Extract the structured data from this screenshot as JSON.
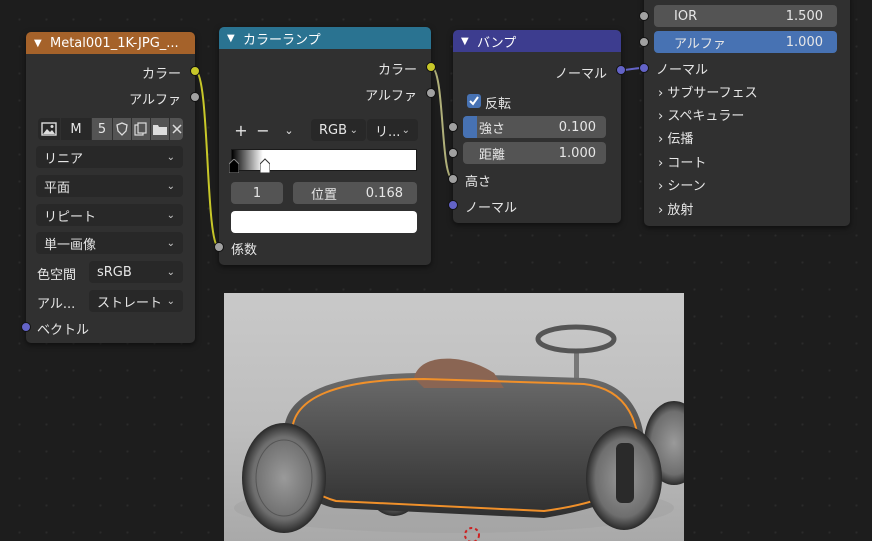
{
  "image_node": {
    "title": "Metal001_1K-JPG_...",
    "out_color": "カラー",
    "out_alpha": "アルファ",
    "image_name": "M",
    "users": "5",
    "interpolation": "リニア",
    "projection": "平面",
    "extension": "リピート",
    "source": "単一画像",
    "colorspace_label": "色空間",
    "colorspace_value": "sRGB",
    "alpha_label": "アル...",
    "alpha_value": "ストレート",
    "in_vector": "ベクトル"
  },
  "ramp_node": {
    "title": "カラーランプ",
    "out_color": "カラー",
    "out_alpha": "アルファ",
    "add": "+",
    "remove": "−",
    "color_mode": "RGB",
    "interp": "リ...",
    "index": "1",
    "pos_label": "位置",
    "pos_value": "0.168",
    "pos_fraction": 0.168,
    "in_factor": "係数"
  },
  "bump_node": {
    "title": "バンプ",
    "out_normal": "ノーマル",
    "invert_label": "反転",
    "strength_label": "強さ",
    "strength_value": "0.100",
    "distance_label": "距離",
    "distance_value": "1.000",
    "in_height": "高さ",
    "in_normal": "ノーマル"
  },
  "bsdf_node": {
    "ior_label": "IOR",
    "ior_value": "1.500",
    "alpha_label": "アルファ",
    "alpha_value": "1.000",
    "normal_label": "ノーマル",
    "panels": [
      "サブサーフェス",
      "スペキュラー",
      "伝播",
      "コート",
      "シーン",
      "放射"
    ]
  },
  "colors": {
    "image_header": "#a5622a",
    "ramp_header": "#2a7391",
    "bump_header": "#3d3d8f",
    "color_socket": "#c7c729",
    "float_socket": "#a1a1a1",
    "vector_socket": "#6363c7",
    "accent": "#4772b3",
    "selection_outline": "#f0902a"
  }
}
